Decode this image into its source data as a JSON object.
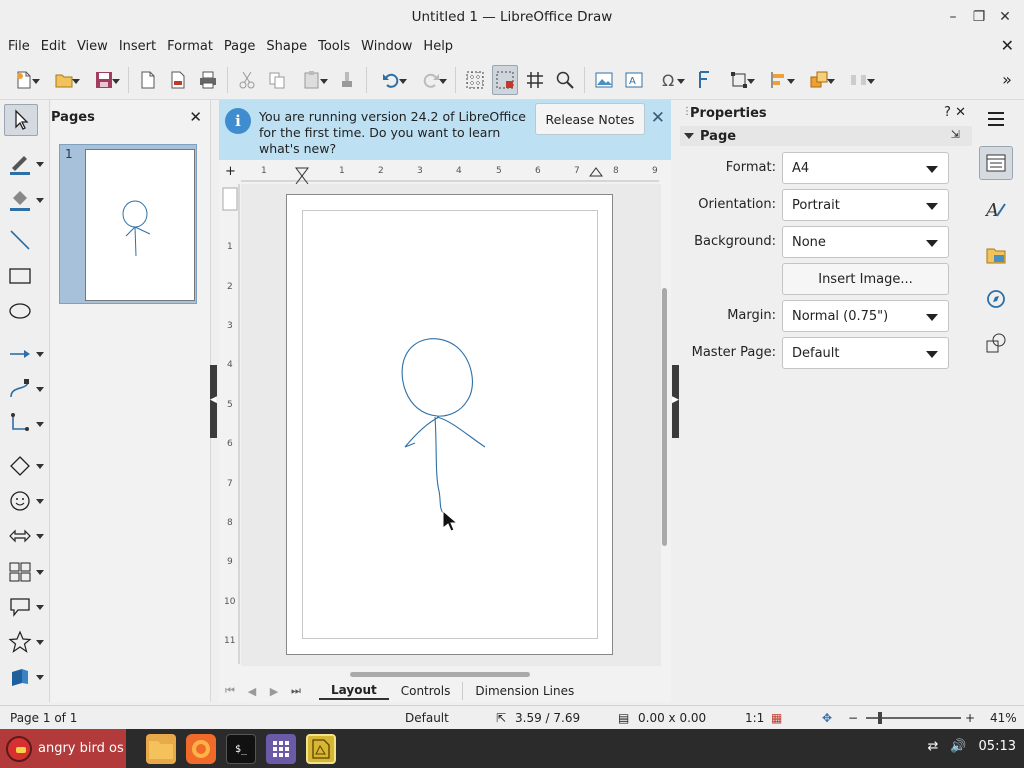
{
  "window": {
    "title": "Untitled 1 — LibreOffice Draw"
  },
  "menu": [
    "File",
    "Edit",
    "View",
    "Insert",
    "Format",
    "Page",
    "Shape",
    "Tools",
    "Window",
    "Help"
  ],
  "pages_panel": {
    "title": "Pages",
    "thumb_number": "1"
  },
  "infobar": {
    "message": "You are running version 24.2 of LibreOffice for the first time. Do you want to learn what's new?",
    "button": "Release Notes"
  },
  "rulers": {
    "horizontal": [
      "1",
      "1",
      "2",
      "3",
      "4",
      "5",
      "6",
      "7",
      "8",
      "9"
    ],
    "vertical": [
      "1",
      "2",
      "3",
      "4",
      "5",
      "6",
      "7",
      "8",
      "9",
      "10",
      "11"
    ]
  },
  "tabs": [
    "Layout",
    "Controls",
    "Dimension Lines"
  ],
  "properties": {
    "title": "Properties",
    "help": "?",
    "section": "Page",
    "format_label": "Format:",
    "format_value": "A4",
    "orientation_label": "Orientation:",
    "orientation_value": "Portrait",
    "background_label": "Background:",
    "background_value": "None",
    "insert_image": "Insert Image...",
    "margin_label": "Margin:",
    "margin_value": "Normal (0.75\")",
    "master_label": "Master Page:",
    "master_value": "Default"
  },
  "status": {
    "page": "Page 1 of 1",
    "style": "Default",
    "position": "3.59 / 7.69",
    "size": "0.00 x 0.00",
    "scale": "1:1",
    "zoom": "41%"
  },
  "taskbar": {
    "start_label": "angry bird os",
    "clock": "05:13"
  },
  "colors": {
    "accent": "#3f8ccf",
    "infobar": "#bde0f3",
    "thumb_selected": "#a6c1d9",
    "drawing_stroke": "#2f6fa6",
    "start": "#b23a3a"
  }
}
